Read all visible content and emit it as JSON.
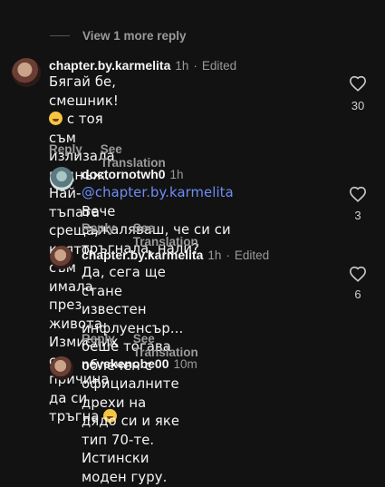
{
  "view_more": "View 1 more reply",
  "comments": [
    {
      "username": "chapter.by.karmelita",
      "time": "1h",
      "edited": "Edited",
      "line1_a": "Бягай бе, смешник!",
      "line1_b": "с тоя съм",
      "line2": "излизала веднъж. Най-тъпата среща,",
      "line3": "която съм имала през живота. Измислих",
      "line4": "си причина да си тръгна",
      "likes": "30",
      "reply_label": "Reply",
      "translate_label": "See Translation"
    },
    {
      "username": "doctornotwh0",
      "time": "1h",
      "mention": "@chapter.by.karmelita",
      "line1_rest": "Вече",
      "line2": "съжаляваш, че си си тръгнала, нали?",
      "likes": "3",
      "reply_label": "Reply",
      "translate_label": "See Translation"
    },
    {
      "username": "chapter.by.karmelita",
      "time": "1h",
      "edited": "Edited",
      "line1": "Да, сега ще стане известен",
      "line2": "инфлуенсър... беше тогава облечен с",
      "line3": "официалните дрехи на дядо си и яке",
      "line4": "тип 70-те. Истински моден гуру.",
      "likes": "6",
      "reply_label": "Reply",
      "translate_label": "See Translation"
    },
    {
      "username": "nevekenobe00",
      "time": "10m"
    }
  ]
}
